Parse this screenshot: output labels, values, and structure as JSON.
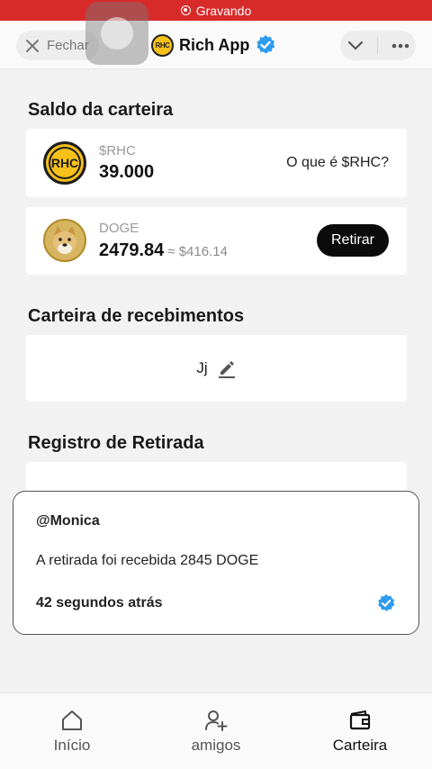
{
  "status_bar": {
    "recording_label": "Gravando"
  },
  "header": {
    "close_label": "Fechar",
    "title": "Rich App",
    "logo_text": "RHC"
  },
  "wallet_balance": {
    "title": "Saldo da carteira",
    "rhc": {
      "logo_text": "RHC",
      "name": "$RHC",
      "amount": "39.000",
      "link": "O que é $RHC?"
    },
    "doge": {
      "name": "DOGE",
      "amount": "2479.84",
      "approx": "≈ $416.14",
      "withdraw_label": "Retirar"
    }
  },
  "receiving_wallet": {
    "title": "Carteira de recebimentos",
    "value": "Jj"
  },
  "withdraw_log": {
    "title": "Registro de Retirada"
  },
  "notification": {
    "user": "@Monica",
    "message": "A retirada foi recebida 2845 DOGE",
    "time": "42 segundos atrás"
  },
  "bottom_nav": {
    "items": [
      {
        "label": "Início",
        "icon": "home-icon",
        "active": false
      },
      {
        "label": "amigos",
        "icon": "add-friend-icon",
        "active": false
      },
      {
        "label": "Carteira",
        "icon": "wallet-icon",
        "active": true
      }
    ]
  },
  "colors": {
    "recording_bar": "#d92a2a",
    "verified_blue": "#2e9bef",
    "rhc_gold": "#f7c11a",
    "button_black": "#0b0b0b"
  }
}
